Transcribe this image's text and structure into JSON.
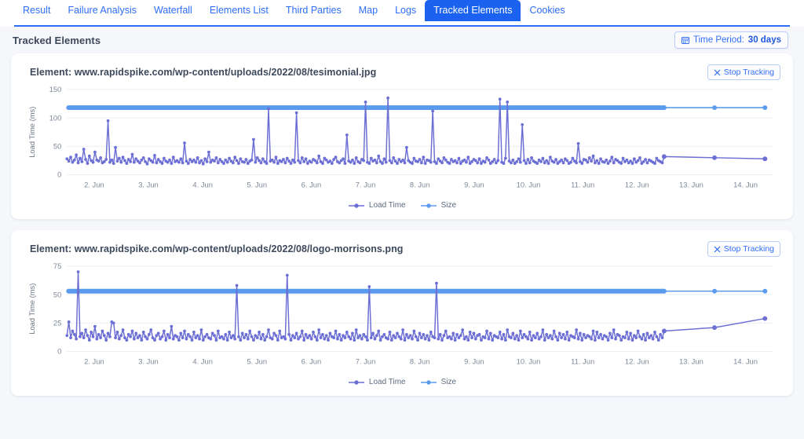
{
  "tabs": [
    {
      "label": "Result",
      "active": false
    },
    {
      "label": "Failure Analysis",
      "active": false
    },
    {
      "label": "Waterfall",
      "active": false
    },
    {
      "label": "Elements List",
      "active": false
    },
    {
      "label": "Third Parties",
      "active": false
    },
    {
      "label": "Map",
      "active": false
    },
    {
      "label": "Logs",
      "active": false
    },
    {
      "label": "Tracked Elements",
      "active": true
    },
    {
      "label": "Cookies",
      "active": false
    }
  ],
  "header": {
    "title": "Tracked Elements",
    "time_period_label": "Time Period:",
    "time_period_value": "30 days",
    "calendar_icon": "calendar-icon"
  },
  "colors": {
    "accent": "#2f6df6",
    "active_tab_bg": "#1a62ef",
    "load_time": "#6c6fd4",
    "size": "#5b9bee",
    "page_bg": "#f5f7fb",
    "card_bg": "#ffffff",
    "grid": "#eceff4",
    "tick_text": "#7d8797"
  },
  "cards": [
    {
      "title": "Element: www.rapidspike.com/wp-content/uploads/2022/08/tesimonial.jpg",
      "stop_button_label": "Stop Tracking",
      "close_icon": "close-icon",
      "chart_data": {
        "type": "line",
        "title": "",
        "xlabel": "",
        "ylabel": "Load Time (ms)",
        "ylim": [
          0,
          150
        ],
        "yticks": [
          0,
          50,
          100,
          150
        ],
        "grid": true,
        "legend_position": "bottom",
        "x": [
          "2. Jun",
          "3. Jun",
          "4. Jun",
          "5. Jun",
          "6. Jun",
          "7. Jun",
          "8. Jun",
          "9. Jun",
          "10. Jun",
          "11. Jun",
          "12. Jun",
          "13. Jun",
          "14. Jun"
        ],
        "series": [
          {
            "name": "Load Time",
            "color": "#6c6fd4",
            "note": "high-frequency samples, baseline ~22-30 ms with frequent spikes to 40-60 and occasional spikes to 90-135 ms; sampling becomes sparse after 12. Jun",
            "values": [
              28,
              24,
              31,
              22,
              26,
              35,
              21,
              29,
              23,
              45,
              27,
              20,
              33,
              25,
              22,
              40,
              26,
              24,
              30,
              21,
              23,
              27,
              95,
              22,
              26,
              20,
              48,
              24,
              29,
              22,
              31,
              25,
              20,
              27,
              23,
              36,
              22,
              28,
              24,
              21,
              26,
              30,
              23,
              19,
              28,
              25,
              22,
              34,
              21,
              27,
              23,
              20,
              29,
              24,
              22,
              26,
              20,
              31,
              23,
              25,
              22,
              28,
              21,
              56,
              24,
              20,
              27,
              23,
              26,
              22,
              30,
              21,
              25,
              19,
              28,
              23,
              40,
              22,
              26,
              24,
              30,
              21,
              27,
              23,
              20,
              26,
              22,
              29,
              24,
              21,
              31,
              25,
              20,
              28,
              23,
              22,
              27,
              20,
              24,
              26,
              62,
              22,
              30,
              25,
              21,
              28,
              23,
              20,
              116,
              24,
              26,
              22,
              31,
              20,
              25,
              23,
              27,
              21,
              29,
              24,
              20,
              26,
              22,
              109,
              25,
              21,
              30,
              23,
              28,
              20,
              24,
              22,
              27,
              25,
              21,
              33,
              23,
              20,
              29,
              26,
              22,
              24,
              20,
              27,
              31,
              23,
              21,
              25,
              28,
              20,
              70,
              24,
              22,
              26,
              20,
              30,
              23,
              21,
              27,
              25,
              128,
              22,
              20,
              29,
              24,
              26,
              21,
              33,
              23,
              20,
              28,
              22,
              135,
              25,
              21,
              30,
              24,
              20,
              27,
              23,
              26,
              21,
              48,
              25,
              22,
              20,
              29,
              24,
              23,
              27,
              21,
              31,
              20,
              26,
              25,
              22,
              112,
              23,
              20,
              28,
              24,
              21,
              30,
              26,
              22,
              20,
              27,
              23,
              25,
              21,
              29,
              20,
              24,
              26,
              22,
              31,
              20,
              23,
              27,
              25,
              21,
              28,
              20,
              24,
              22,
              30,
              26,
              20,
              23,
              27,
              21,
              25,
              133,
              22,
              20,
              29,
              128,
              24,
              21,
              26,
              20,
              23,
              28,
              22,
              88,
              25,
              20,
              27,
              21,
              30,
              24,
              22,
              20,
              26,
              23,
              29,
              21,
              25,
              20,
              31,
              24,
              22,
              27,
              20,
              23,
              26,
              21,
              28,
              25,
              20,
              22,
              29,
              24,
              21,
              55,
              23,
              20,
              27,
              26,
              22,
              30,
              24,
              33,
              21,
              25,
              20,
              28,
              23,
              22,
              26,
              20,
              24,
              31,
              21,
              27,
              25,
              22,
              20,
              29,
              23,
              26,
              21,
              24,
              20,
              28,
              22,
              25,
              30,
              20,
              23,
              27,
              21,
              26,
              24,
              22,
              20,
              29,
              25,
              23,
              21,
              32,
              30,
              28
            ]
          },
          {
            "name": "Size",
            "color": "#5b9bee",
            "note": "constant size value rendered as flat band at ~118 on the load-time axis; sparse points after 12. Jun",
            "values": [
              118,
              118,
              118,
              118,
              118,
              118,
              118,
              118,
              118,
              118,
              118,
              118,
              118
            ]
          }
        ]
      }
    },
    {
      "title": "Element: www.rapidspike.com/wp-content/uploads/2022/08/logo-morrisons.png",
      "stop_button_label": "Stop Tracking",
      "close_icon": "close-icon",
      "chart_data": {
        "type": "line",
        "title": "",
        "xlabel": "",
        "ylabel": "Load Time (ms)",
        "ylim": [
          0,
          75
        ],
        "yticks": [
          0,
          25,
          50,
          75
        ],
        "grid": true,
        "legend_position": "bottom",
        "x": [
          "2. Jun",
          "3. Jun",
          "4. Jun",
          "5. Jun",
          "6. Jun",
          "7. Jun",
          "8. Jun",
          "9. Jun",
          "10. Jun",
          "11. Jun",
          "12. Jun",
          "13. Jun",
          "14. Jun"
        ],
        "series": [
          {
            "name": "Load Time",
            "color": "#6c6fd4",
            "note": "baseline ~12-18 ms with regular spikes to 22-30 and occasional spikes to 55-70 ms; sampling becomes sparse after 12. Jun, trending up to ~29 ms",
            "values": [
              14,
              26,
              12,
              18,
              15,
              11,
              70,
              13,
              16,
              12,
              19,
              14,
              10,
              17,
              13,
              22,
              11,
              15,
              12,
              18,
              14,
              10,
              16,
              13,
              26,
              25,
              12,
              17,
              11,
              14,
              19,
              12,
              10,
              15,
              13,
              18,
              11,
              16,
              12,
              14,
              10,
              17,
              13,
              11,
              15,
              19,
              12,
              10,
              14,
              16,
              11,
              13,
              18,
              10,
              15,
              12,
              22,
              11,
              14,
              13,
              10,
              16,
              12,
              18,
              11,
              15,
              13,
              10,
              17,
              12,
              14,
              11,
              19,
              10,
              13,
              15,
              12,
              11,
              16,
              14,
              10,
              18,
              12,
              13,
              11,
              15,
              10,
              17,
              12,
              14,
              11,
              58,
              13,
              10,
              16,
              12,
              15,
              11,
              18,
              13,
              10,
              14,
              12,
              17,
              11,
              15,
              10,
              13,
              19,
              12,
              11,
              16,
              14,
              10,
              18,
              12,
              13,
              11,
              67,
              15,
              10,
              14,
              12,
              16,
              11,
              13,
              18,
              10,
              15,
              12,
              14,
              11,
              17,
              13,
              10,
              19,
              12,
              15,
              11,
              14,
              10,
              16,
              13,
              12,
              18,
              11,
              15,
              10,
              14,
              12,
              17,
              13,
              11,
              16,
              10,
              19,
              12,
              14,
              11,
              15,
              13,
              10,
              57,
              12,
              16,
              11,
              14,
              18,
              10,
              13,
              15,
              12,
              11,
              17,
              10,
              14,
              12,
              16,
              13,
              11,
              19,
              10,
              15,
              12,
              14,
              11,
              18,
              13,
              10,
              16,
              12,
              15,
              11,
              14,
              10,
              17,
              13,
              12,
              60,
              11,
              15,
              10,
              14,
              18,
              12,
              13,
              11,
              16,
              10,
              15,
              12,
              14,
              19,
              11,
              13,
              10,
              17,
              12,
              16,
              11,
              14,
              15,
              10,
              13,
              12,
              18,
              11,
              16,
              10,
              14,
              13,
              12,
              17,
              11,
              15,
              10,
              19,
              13,
              12,
              16,
              11,
              14,
              10,
              18,
              12,
              15,
              13,
              11,
              17,
              10,
              14,
              12,
              16,
              11,
              13,
              19,
              10,
              15,
              12,
              14,
              11,
              18,
              13,
              10,
              16,
              12,
              15,
              11,
              17,
              10,
              14,
              13,
              12,
              19,
              11,
              16,
              10,
              15,
              12,
              14,
              13,
              11,
              18,
              10,
              17,
              12,
              15,
              11,
              14,
              13,
              10,
              16,
              12,
              19,
              11,
              15,
              14,
              10,
              13,
              12,
              17,
              11,
              16,
              10,
              14,
              12,
              18,
              13,
              11,
              15,
              10,
              16,
              12,
              14,
              11,
              17,
              13,
              10,
              15,
              12,
              18,
              21,
              29
            ]
          },
          {
            "name": "Size",
            "color": "#5b9bee",
            "note": "constant size value rendered as flat band at ~53 on the load-time axis; sparse points after 12. Jun",
            "values": [
              53,
              53,
              53,
              53,
              53,
              53,
              53,
              53,
              53,
              53,
              53,
              53,
              53
            ]
          }
        ]
      }
    }
  ],
  "legend": {
    "load_time": "Load Time",
    "size": "Size"
  }
}
